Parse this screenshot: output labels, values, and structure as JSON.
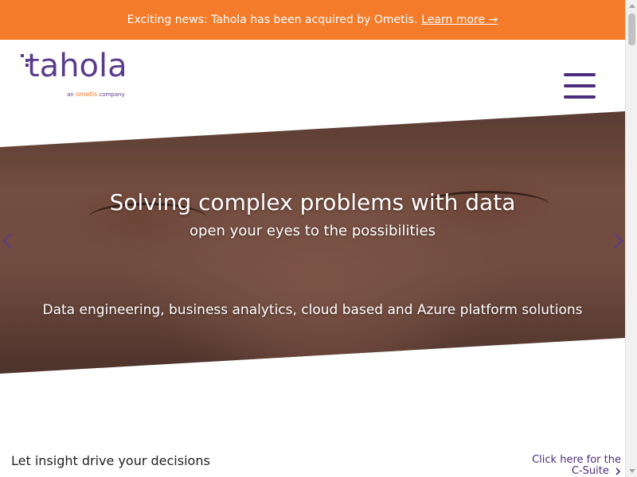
{
  "announcement": {
    "text": "Exciting news: Tahola has been acquired by Ometis.",
    "link_label": "Learn more →"
  },
  "logo": {
    "wordmark": "tahola",
    "tagline_prefix": "an",
    "tagline_brand": "ometis",
    "tagline_suffix": "company"
  },
  "hero": {
    "title": "Solving complex problems with data",
    "subtitle": "open your eyes to the possibilities",
    "description": "Data engineering, business analytics, cloud based and Azure platform solutions"
  },
  "section": {
    "heading": "Let insight drive your decisions",
    "csuite_line1": "Click here for the",
    "csuite_line2": "C-Suite"
  },
  "colors": {
    "accent_orange": "#f47b2a",
    "brand_purple": "#4b2c7e"
  },
  "icons": {
    "menu": "hamburger-menu-icon",
    "prev": "chevron-left-icon",
    "next": "chevron-right-icon",
    "csuite": "chevron-right-icon"
  }
}
